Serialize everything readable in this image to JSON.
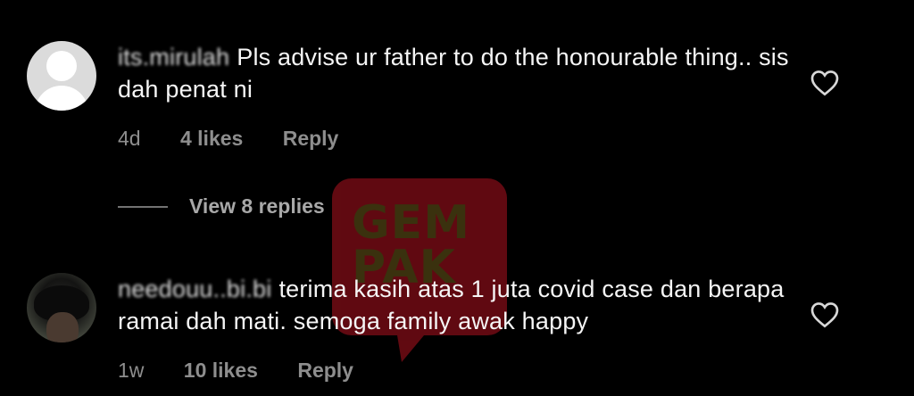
{
  "comments": [
    {
      "username": "its.mirulah",
      "text": "Pls advise ur father to do the honourable thing.. sis dah penat ni",
      "time": "4d",
      "likes": "4 likes",
      "reply_label": "Reply",
      "heart_icon": "heart-outline-icon"
    },
    {
      "username": "needouu..bi.bi",
      "text": "terima kasih atas 1 juta covid case dan berapa ramai dah mati. semoga family awak happy",
      "time": "1w",
      "likes": "10 likes",
      "reply_label": "Reply",
      "heart_icon": "heart-outline-icon"
    }
  ],
  "view_replies": "View 8 replies",
  "watermark": {
    "line1": "GEM",
    "line2": "PAK"
  },
  "colors": {
    "background": "#000000",
    "text": "#f5f5f5",
    "meta": "#8e8e8e",
    "watermark_red": "#b0121f"
  }
}
